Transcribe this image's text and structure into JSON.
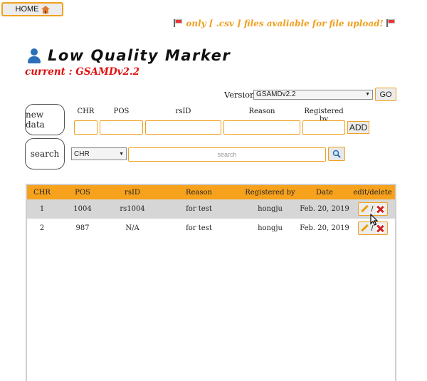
{
  "home": {
    "label": "HOME",
    "icon": "house-icon"
  },
  "notice": {
    "text": "only [ .csv ] files avaliable for file upload!",
    "icon": "flag-icon"
  },
  "header": {
    "title": "Low Quality Marker",
    "icon": "user-icon",
    "current": "current : GSAMDv2.2"
  },
  "version": {
    "label": "Version :",
    "selected": "GSAMDv2.2",
    "go_label": "GO"
  },
  "new_data": {
    "button_label": "new data",
    "columns": [
      "CHR",
      "POS",
      "rsID",
      "Reason",
      "Registered by"
    ],
    "add_label": "ADD"
  },
  "search": {
    "button_label": "search",
    "field_selected": "CHR",
    "placeholder": "search"
  },
  "table": {
    "headers": [
      "CHR",
      "POS",
      "rsID",
      "Reason",
      "Registered by",
      "Date",
      "edit/delete"
    ],
    "rows": [
      {
        "chr": "1",
        "pos": "1004",
        "rsid": "rs1004",
        "reason": "for test",
        "registered_by": "hongju",
        "date": "Feb. 20, 2019"
      },
      {
        "chr": "2",
        "pos": "987",
        "rsid": "N/A",
        "reason": "for test",
        "registered_by": "hongju",
        "date": "Feb. 20, 2019"
      }
    ],
    "edit_separator": "/"
  },
  "colors": {
    "accent": "#f7a21c",
    "current": "#e01010",
    "notice": "#f0a020"
  }
}
